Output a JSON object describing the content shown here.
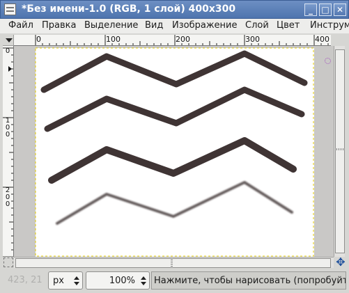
{
  "window": {
    "title": "*Без имени-1.0 (RGB, 1 слой) 400x300",
    "minimize_label": "_",
    "maximize_label": "□",
    "close_label": "✕"
  },
  "menu": [
    {
      "label": "Файл"
    },
    {
      "label": "Правка"
    },
    {
      "label": "Выделение"
    },
    {
      "label": "Вид"
    },
    {
      "label": "Изображение"
    },
    {
      "label": "Слой"
    },
    {
      "label": "Цвет"
    },
    {
      "label": "Инструм"
    }
  ],
  "ruler": {
    "h_labels": [
      "0",
      "100",
      "200",
      "300",
      "400"
    ],
    "v_labels": [
      "0",
      "100",
      "200"
    ]
  },
  "canvas": {
    "image_width": 400,
    "image_height": 300,
    "stroke_color": "#3f3434",
    "strokes": [
      {
        "style": "hard",
        "points": [
          [
            12,
            60
          ],
          [
            102,
            12
          ],
          [
            202,
            52
          ],
          [
            300,
            8
          ],
          [
            386,
            50
          ]
        ]
      },
      {
        "style": "hard",
        "points": [
          [
            17,
            116
          ],
          [
            102,
            73
          ],
          [
            202,
            108
          ],
          [
            300,
            60
          ],
          [
            382,
            95
          ]
        ]
      },
      {
        "style": "hard",
        "points": [
          [
            23,
            190
          ],
          [
            102,
            146
          ],
          [
            198,
            180
          ],
          [
            300,
            133
          ],
          [
            370,
            174
          ]
        ]
      },
      {
        "style": "soft",
        "points": [
          [
            31,
            252
          ],
          [
            102,
            210
          ],
          [
            198,
            242
          ],
          [
            300,
            193
          ],
          [
            368,
            236
          ]
        ]
      }
    ]
  },
  "status": {
    "pointer_coords": "423, 21",
    "unit": "px",
    "zoom": "100%",
    "message": "Нажмите, чтобы нарисовать (попробуйте Shift)"
  }
}
